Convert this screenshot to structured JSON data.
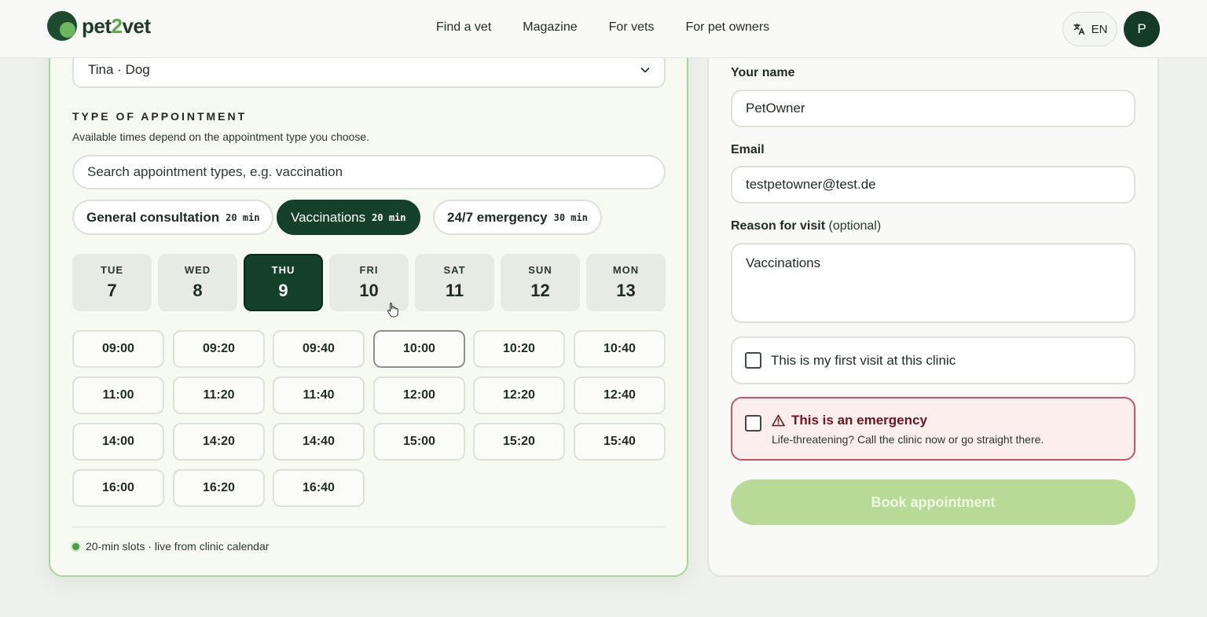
{
  "header": {
    "logo_text_a": "pet",
    "logo_text_b": "2",
    "logo_text_c": "vet",
    "nav": [
      "Find a vet",
      "Magazine",
      "For vets",
      "For pet owners"
    ],
    "language": "EN",
    "avatar_initial": "P"
  },
  "booking": {
    "pet_selected": "Tina · Dog",
    "type_title": "TYPE OF APPOINTMENT",
    "type_desc": "Available times depend on the appointment type you choose.",
    "search_placeholder": "Search appointment types, e.g. vaccination",
    "types": [
      {
        "label": "General consultation",
        "duration": "20 min",
        "active": false
      },
      {
        "label": "Vaccinations",
        "duration": "20 min",
        "active": true
      },
      {
        "label": "24/7 emergency",
        "duration": "30 min",
        "active": false
      }
    ],
    "days": [
      {
        "dow": "TUE",
        "num": "7"
      },
      {
        "dow": "WED",
        "num": "8"
      },
      {
        "dow": "THU",
        "num": "9"
      },
      {
        "dow": "FRI",
        "num": "10"
      },
      {
        "dow": "SAT",
        "num": "11"
      },
      {
        "dow": "SUN",
        "num": "12"
      },
      {
        "dow": "MON",
        "num": "13"
      }
    ],
    "selected_day": "THU 9",
    "slots": [
      "09:00",
      "09:20",
      "09:40",
      "10:00",
      "10:20",
      "10:40",
      "11:00",
      "11:20",
      "11:40",
      "12:00",
      "12:20",
      "12:40",
      "14:00",
      "14:20",
      "14:40",
      "15:00",
      "15:20",
      "15:40",
      "16:00",
      "16:20",
      "16:40"
    ],
    "footer_note": "20-min slots · live from clinic calendar"
  },
  "form": {
    "name_label": "Your name",
    "name_value": "PetOwner",
    "email_label": "Email",
    "email_value": "testpetowner@test.de",
    "reason_label": "Reason for visit",
    "reason_optional": "(optional)",
    "reason_value": "Vaccinations",
    "first_visit_label": "This is my first visit at this clinic",
    "first_visit_checked": false,
    "emergency_title": "This is an emergency",
    "emergency_desc": "Life-threatening? Call the clinic now or go straight there.",
    "emergency_checked": false,
    "book_button": "Book appointment"
  },
  "colors": {
    "brand_dark": "#15402a",
    "brand_green": "#5aa94a",
    "book_disabled": "#b7db97",
    "emergency_border": "#c45665"
  }
}
